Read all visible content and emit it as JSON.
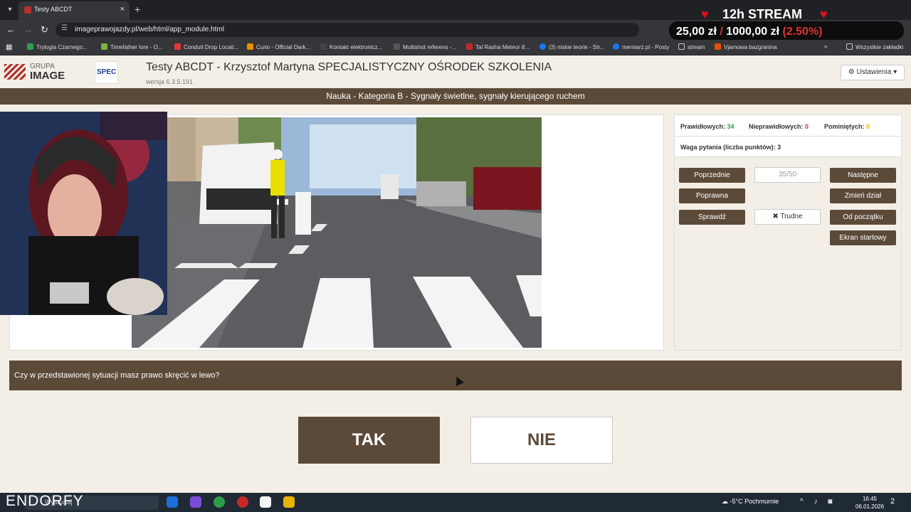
{
  "browser": {
    "tab_title": "Testy ABCDT",
    "url": "imageprawojazdy.pl/web/html/app_module.html",
    "bookmarks": [
      "Trylogia Czarnego...",
      "Timefather lore - O...",
      "Conduit Drop Locati...",
      "Curio - Official Dark...",
      "Kontakt elektronicz...",
      "Multishot referens -...",
      "Tal Rasha Meteor 8...",
      "(3) niskie teorie - Str...",
      "memiarz.pl - Posty",
      "stream",
      "Vjamowa bazgranina",
      "Wszystkie zakładki"
    ]
  },
  "stream": {
    "title": "12h STREAM",
    "amount_current": "25,00 zł",
    "separator": "/",
    "amount_goal": "1000,00 zł",
    "percent": "(2.50%)"
  },
  "header": {
    "logo_grupa": "GRUPA",
    "logo_image": "IMAGE",
    "logo_spec": "SPEC",
    "title": "Testy ABCDT - Krzysztof Martyna SPECJALISTYCZNY OŚRODEK SZKOLENIA",
    "version": "wersja 6.3.5.191",
    "settings": "Ustawienia"
  },
  "section": "Nauka - Kategoria B - Sygnały świetlne, sygnały kierującego ruchem",
  "stats": {
    "correct_label": "Prawidłowych:",
    "correct_value": "34",
    "wrong_label": "Nieprawidłowych:",
    "wrong_value": "0",
    "skipped_label": "Pominiętych:",
    "skipped_value": "0",
    "weight": "Waga pytania (liczba punktów): 3"
  },
  "controls": {
    "prev": "Poprzednie",
    "counter": "35/50",
    "next": "Następne",
    "correct": "Poprawna",
    "change": "Zmień dział",
    "check": "Sprawdź",
    "hard": "Trudne",
    "restart": "Od początku",
    "home": "Ekran startowy"
  },
  "question": "Czy w przedstawionej sytuacji masz prawo skręcić w lewo?",
  "answers": {
    "yes": "TAK",
    "no": "NIE"
  },
  "taskbar": {
    "brand": "ENDORFY",
    "search_placeholder": "Wyszukaj",
    "weather": "-5°C  Pochmurnie",
    "time": "16:45",
    "date": "06.01.2026",
    "notifications": "2"
  }
}
